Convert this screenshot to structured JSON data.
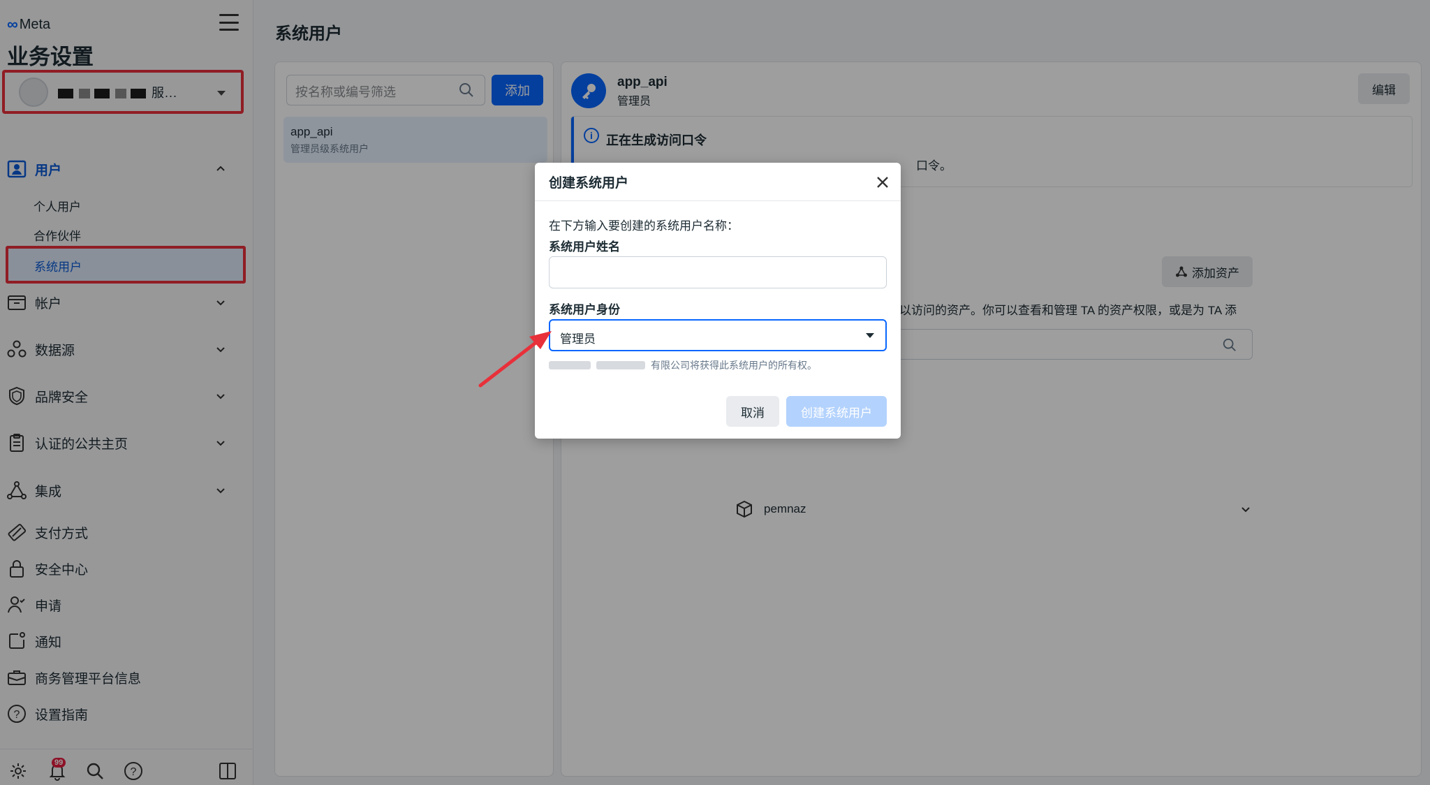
{
  "sidebar": {
    "brand": "Meta",
    "heading": "业务设置",
    "account_suffix": "服...",
    "nav": {
      "users": "用户",
      "users_sub": [
        "个人用户",
        "合作伙伴",
        "系统用户"
      ],
      "accounts": "帐户",
      "data_sources": "数据源",
      "brand_safety": "品牌安全",
      "verified_pages": "认证的公共主页",
      "integrations": "集成",
      "payment_methods": "支付方式",
      "security_center": "安全中心",
      "requests": "申请",
      "notifications": "通知",
      "business_info": "商务管理平台信息",
      "setup_guide": "设置指南"
    },
    "notification_badge": "99"
  },
  "main": {
    "title": "系统用户",
    "filter_placeholder": "按名称或编号筛选",
    "add_button": "添加",
    "list": [
      {
        "name": "app_api",
        "subtitle": "管理员级系统用户"
      }
    ]
  },
  "detail": {
    "name": "app_api",
    "role": "管理员",
    "edit_button": "编辑",
    "info_title": "正在生成访问口令",
    "info_desc": "口令。",
    "add_asset_button": "添加资产",
    "asset_desc": "以访问的资产。你可以查看和管理 TA 的资产权限，或是为 TA 添",
    "asset_name": "pemnaz"
  },
  "dialog": {
    "title": "创建系统用户",
    "instruction": "在下方输入要创建的系统用户名称：",
    "name_label": "系统用户姓名",
    "name_value": "",
    "role_label": "系统用户身份",
    "role_value": "管理员",
    "ownership_note": "有限公司将获得此系统用户的所有权。",
    "cancel": "取消",
    "create": "创建系统用户"
  },
  "colors": {
    "accent": "#0866ff",
    "annotation_red": "#e8303a"
  }
}
